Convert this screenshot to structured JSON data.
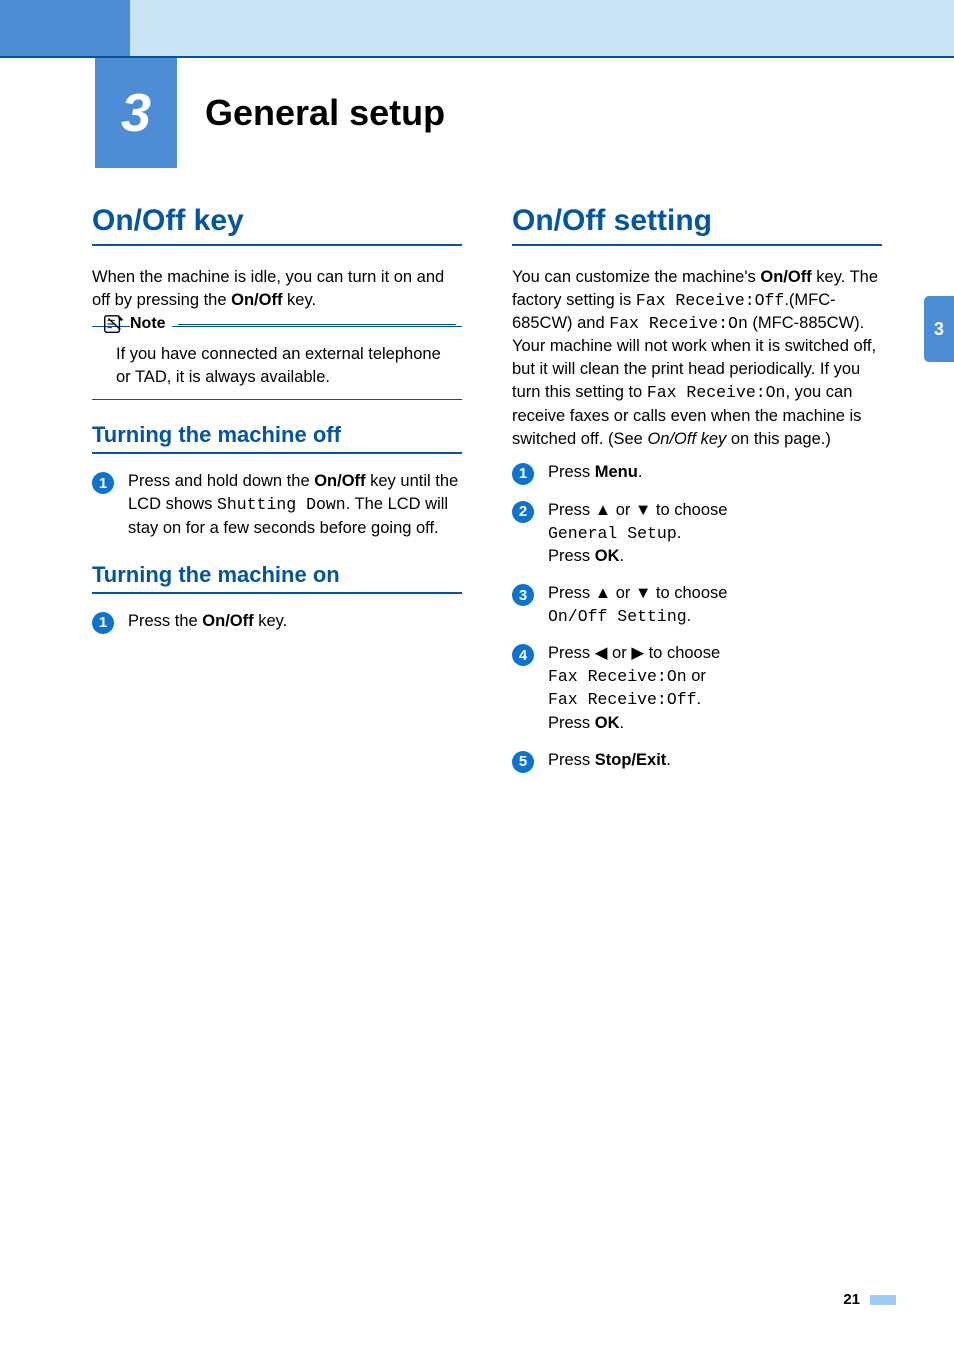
{
  "chapter": {
    "number": "3",
    "title": "General setup",
    "sideTab": "3"
  },
  "pageNumber": "21",
  "left": {
    "h1": "On/Off key",
    "intro": {
      "t1": "When the machine is idle, you can turn it on and off by pressing the ",
      "b1": "On/Off",
      "t2": " key."
    },
    "note": {
      "label": "Note",
      "text": "If you have connected an external telephone or TAD, it is always available."
    },
    "secOff": {
      "title": "Turning the machine off",
      "step1": {
        "num": "1",
        "t1": "Press and hold down the ",
        "b1": "On/Off",
        "t2": " key until the LCD shows ",
        "m1": "Shutting Down",
        "t3": ". The LCD will stay on for a few seconds before going off."
      }
    },
    "secOn": {
      "title": "Turning the machine on",
      "step1": {
        "num": "1",
        "t1": "Press the ",
        "b1": "On/Off",
        "t2": " key."
      }
    }
  },
  "right": {
    "h1": "On/Off setting",
    "intro": {
      "t1": "You can customize the machine's ",
      "b1": "On/Off",
      "t2": " key. The factory setting is ",
      "m1": "Fax Receive:Off",
      "t3": ".(MFC-685CW) and ",
      "m2": "Fax Receive:On",
      "t4": " (MFC-885CW). Your machine will not work when it is switched off, but it will clean the print head periodically. If you turn this setting to ",
      "m3": "Fax Receive:On",
      "t5": ", you can receive faxes or calls even when the machine is switched off. (See ",
      "i1": "On/Off key",
      "t6": " on this page.)"
    },
    "steps": {
      "s1": {
        "num": "1",
        "t1": "Press ",
        "b1": "Menu",
        "t2": "."
      },
      "s2": {
        "num": "2",
        "t1": "Press ",
        "a1": "▲",
        "t2": " or ",
        "a2": "▼",
        "t3": " to choose ",
        "m1": "General Setup",
        "t4": ".",
        "t5": "Press ",
        "b1": "OK",
        "t6": "."
      },
      "s3": {
        "num": "3",
        "t1": "Press ",
        "a1": "▲",
        "t2": " or ",
        "a2": "▼",
        "t3": " to choose ",
        "m1": "On/Off Setting",
        "t4": "."
      },
      "s4": {
        "num": "4",
        "t1": "Press ",
        "a1": "◀",
        "t2": " or ",
        "a2": "▶",
        "t3": " to choose ",
        "m1": "Fax Receive:On",
        "t4": " or ",
        "m2": "Fax Receive:Off",
        "t5": ".",
        "t6": "Press ",
        "b1": "OK",
        "t7": "."
      },
      "s5": {
        "num": "5",
        "t1": "Press ",
        "b1": "Stop/Exit",
        "t2": "."
      }
    }
  }
}
